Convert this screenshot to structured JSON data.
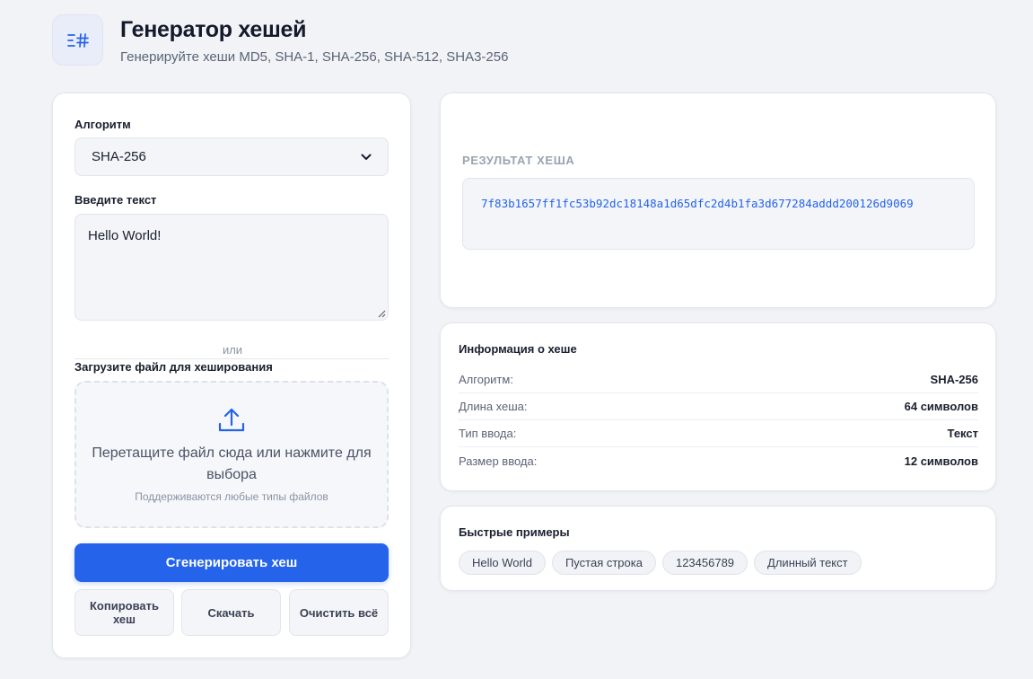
{
  "header": {
    "title": "Генератор хешей",
    "subtitle": "Генерируйте хеши MD5, SHA-1, SHA-256, SHA-512, SHA3-256"
  },
  "form": {
    "algorithm_label": "Алгоритм",
    "algorithm_value": "SHA-256",
    "text_label": "Введите текст",
    "text_value": "Hello World!",
    "or_label": "или",
    "file_label": "Загрузите файл для хеширования",
    "dropzone_main": "Перетащите файл сюда или нажмите для выбора",
    "dropzone_sub": "Поддерживаются любые типы файлов",
    "generate_label": "Сгенерировать хеш",
    "copy_label": "Копировать хеш",
    "download_label": "Скачать",
    "clear_label": "Очистить всё"
  },
  "result": {
    "label": "РЕЗУЛЬТАТ ХЕША",
    "hash": "7f83b1657ff1fc53b92dc18148a1d65dfc2d4b1fa3d677284addd200126d9069"
  },
  "info": {
    "title": "Информация о хеше",
    "rows": [
      {
        "key": "Алгоритм:",
        "value": "SHA-256"
      },
      {
        "key": "Длина хеша:",
        "value": "64 символов"
      },
      {
        "key": "Тип ввода:",
        "value": "Текст"
      },
      {
        "key": "Размер ввода:",
        "value": "12 символов"
      }
    ]
  },
  "quick": {
    "title": "Быстрые примеры",
    "examples": [
      "Hello World",
      "Пустая строка",
      "123456789",
      "Длинный текст"
    ]
  },
  "colors": {
    "accent": "#2563eb",
    "background": "#f1f3f7"
  },
  "icons": {
    "logo": "hash-icon",
    "dropzone": "upload-icon",
    "select": "chevron-down-icon"
  }
}
